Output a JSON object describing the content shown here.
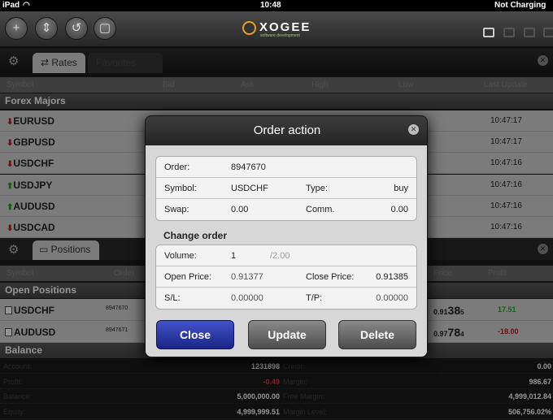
{
  "status_bar": {
    "device": "iPad",
    "time": "10:48",
    "battery": "Not Charging"
  },
  "toolbar": {
    "logo_text": "XOGEE",
    "logo_sub": "software development"
  },
  "rates_panel": {
    "tab_active": "Rates",
    "tab_inactive": "Favorites",
    "headers": [
      "Symbol",
      "Bid",
      "Ask",
      "High",
      "Low",
      "Last Update"
    ],
    "section": "Forex Majors",
    "rows": [
      {
        "symbol": "EURUSD",
        "dir": "down",
        "time": "10:47:17"
      },
      {
        "symbol": "GBPUSD",
        "dir": "down",
        "time": "10:47:17"
      },
      {
        "symbol": "USDCHF",
        "dir": "down",
        "time": "10:47:16"
      },
      {
        "symbol": "USDJPY",
        "dir": "up",
        "time": "10:47:16"
      },
      {
        "symbol": "AUDUSD",
        "dir": "up",
        "time": "10:47:16"
      },
      {
        "symbol": "USDCAD",
        "dir": "down",
        "time": "10:47:16"
      }
    ]
  },
  "positions_panel": {
    "tab": "Positions",
    "headers": [
      "Symbol",
      "Order",
      "Price",
      "Profit"
    ],
    "section": "Open Positions",
    "rows": [
      {
        "symbol": "USDCHF",
        "order": "8947670",
        "price_a": "0.91",
        "price_b": "38",
        "price_c": "5",
        "profit": "17.51",
        "profit_color": "#2a2"
      },
      {
        "symbol": "AUDUSD",
        "order": "8947671",
        "price_a": "0.97",
        "price_b": "78",
        "price_c": "4",
        "profit": "-18.00",
        "profit_color": "#c12"
      }
    ]
  },
  "balance": {
    "section": "Balance",
    "rows": [
      {
        "k1": "Account:",
        "v1": "1231898",
        "k2": "Credit:",
        "v2": "0.00",
        "c1": "#fff"
      },
      {
        "k1": "Profit:",
        "v1": "-0.49",
        "k2": "Margin:",
        "v2": "986.67",
        "c1": "#e33"
      },
      {
        "k1": "Balance:",
        "v1": "5,000,000.00",
        "k2": "Free Margin:",
        "v2": "4,999,012.84",
        "c1": "#fff"
      },
      {
        "k1": "Equity:",
        "v1": "4,999,999.51",
        "k2": "Margin Level:",
        "v2": "506,756.02%",
        "c1": "#fff"
      }
    ]
  },
  "dialog": {
    "title": "Order action",
    "order_label": "Order:",
    "order_value": "8947670",
    "symbol_label": "Symbol:",
    "symbol_value": "USDCHF",
    "type_label": "Type:",
    "type_value": "buy",
    "swap_label": "Swap:",
    "swap_value": "0.00",
    "comm_label": "Comm.",
    "comm_value": "0.00",
    "change_order": "Change order",
    "volume_label": "Volume:",
    "volume_value": "1",
    "volume_max": "/2.00",
    "open_price_label": "Open Price:",
    "open_price_value": "0.91377",
    "close_price_label": "Close Price:",
    "close_price_value": "0.91385",
    "sl_label": "S/L:",
    "sl_value": "0.00000",
    "tp_label": "T/P:",
    "tp_value": "0.00000",
    "close_btn": "Close",
    "update_btn": "Update",
    "delete_btn": "Delete"
  }
}
